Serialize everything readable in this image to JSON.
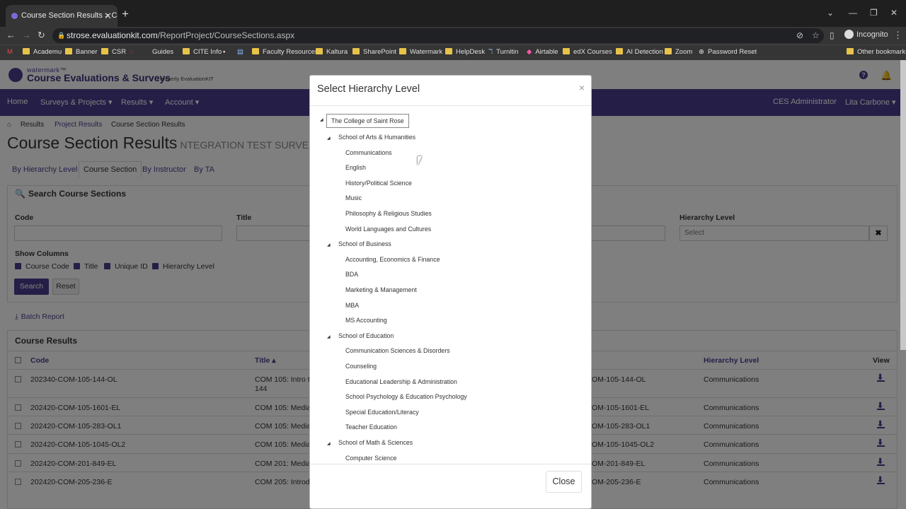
{
  "browser": {
    "tab_title": "Course Section Results > Course",
    "url_host": "strose.evaluationkit.com",
    "url_path": "/ReportProject/CourseSections.aspx",
    "profile_label": "Incognito",
    "bookmarks": [
      "Academu",
      "Banner",
      "CSR",
      "Guides",
      "CITE Info",
      "Faculty Resources",
      "Kaltura",
      "SharePoint",
      "Watermark",
      "HelpDesk",
      "Turnitin",
      "Airtable",
      "edX Courses",
      "AI Detection",
      "Zoom",
      "Password Reset",
      "Other bookmarks"
    ]
  },
  "app": {
    "brand_small": "watermark™",
    "brand_name": "Course Evaluations & Surveys",
    "brand_formerly": "| formerly EvaluationKIT",
    "help_glyph": "?",
    "nav": [
      "Home",
      "Surveys & Projects ▾",
      "Results ▾",
      "Account ▾"
    ],
    "role": "CES Administrator",
    "user": "Lita Carbone ▾"
  },
  "breadcrumb": [
    "Results",
    "Project Results",
    "Course Section Results"
  ],
  "page": {
    "title": "Course Section Results",
    "subtitle": "NTEGRATION TEST SURVE",
    "tabs": [
      "By Hierarchy Level",
      "Course Section",
      "By Instructor",
      "By TA"
    ]
  },
  "search": {
    "heading": "Search Course Sections",
    "code_label": "Code",
    "title_label": "Title",
    "hierarchy_label": "Hierarchy Level",
    "hierarchy_placeholder": "Select",
    "clear_glyph": "✖",
    "show_columns_label": "Show Columns",
    "columns": [
      "Course Code",
      "Title",
      "Unique ID",
      "Hierarchy Level"
    ],
    "search_button": "Search",
    "reset_button": "Reset"
  },
  "batch_report": "Batch Report",
  "results": {
    "heading": "Course Results",
    "headers": {
      "code": "Code",
      "title": "Title ▴",
      "hierarchy": "Hierarchy Level",
      "view": "View"
    },
    "rows": [
      {
        "code": "202340-COM-105-144-OL",
        "title": "COM 105: Intro to",
        "title2": "144",
        "uid": "OM-105-144-OL",
        "hierarchy": "Communications"
      },
      {
        "code": "202420-COM-105-1601-EL",
        "title": "COM 105: Media",
        "title2": "",
        "uid": "OM-105-1601-EL",
        "hierarchy": "Communications"
      },
      {
        "code": "202420-COM-105-283-OL1",
        "title": "COM 105: Media",
        "title2": "",
        "uid": "OM-105-283-OL1",
        "hierarchy": "Communications"
      },
      {
        "code": "202420-COM-105-1045-OL2",
        "title": "COM 105: Media",
        "title2": "",
        "uid": "OM-105-1045-OL2",
        "hierarchy": "Communications"
      },
      {
        "code": "202420-COM-201-849-EL",
        "title": "COM 201: Media",
        "title2": "",
        "uid": "OM-201-849-EL",
        "hierarchy": "Communications"
      },
      {
        "code": "202420-COM-205-236-E",
        "title": "COM 205: Introdu",
        "title2": "",
        "uid": "OM-205-236-E",
        "hierarchy": "Communications"
      }
    ]
  },
  "modal": {
    "title": "Select Hierarchy Level",
    "close_x": "×",
    "close_button": "Close",
    "root": "The College of Saint Rose",
    "schools": [
      {
        "name": "School of Arts & Humanities",
        "children": [
          "Communications",
          "English",
          "History/Political Science",
          "Music",
          "Philosophy & Religious Studies",
          "World Languages and Cultures"
        ]
      },
      {
        "name": "School of Business",
        "children": [
          "Accounting, Economics & Finance",
          "BDA",
          "Marketing & Management",
          "MBA",
          "MS Accounting"
        ]
      },
      {
        "name": "School of Education",
        "children": [
          "Communication Sciences & Disorders",
          "Counseling",
          "Educational Leadership & Administration",
          "School Psychology & Education Psychology",
          "Special Education/Literacy",
          "Teacher Education"
        ]
      },
      {
        "name": "School of Math & Sciences",
        "children": [
          "Computer Science"
        ]
      }
    ]
  }
}
